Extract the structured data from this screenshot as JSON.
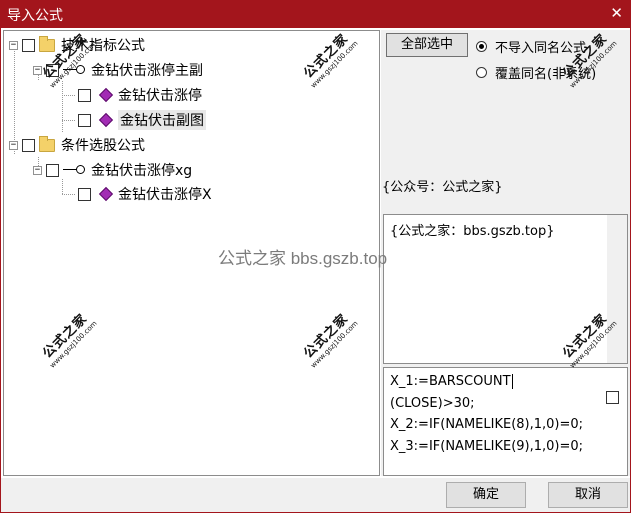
{
  "window": {
    "title": "导入公式",
    "close_symbol": "✕"
  },
  "tree": {
    "expander_minus": "−",
    "items": [
      {
        "label": "技术指标公式",
        "type": "folder"
      },
      {
        "label": "金钻伏击涨停主副",
        "type": "key"
      },
      {
        "label": "金钻伏击涨停",
        "type": "formula"
      },
      {
        "label": "金钻伏击副图",
        "type": "formula",
        "highlighted": true
      },
      {
        "label": "条件选股公式",
        "type": "folder"
      },
      {
        "label": "金钻伏击涨停xg",
        "type": "key"
      },
      {
        "label": "金钻伏击涨停X",
        "type": "formula"
      }
    ]
  },
  "options": {
    "select_all_label": "全部选中",
    "radio_no_import": "不导入同名公式",
    "radio_overwrite": "覆盖同名(非系统)",
    "selected": "radio_no_import"
  },
  "info_label": "{公众号：公式之家}",
  "description": "{公式之家：bbs.gszb.top}",
  "code_lines": [
    "X_1:=BARSCOUNT",
    "(CLOSE)>30;",
    "X_2:=IF(NAMELIKE(8),1,0)=0;",
    "X_3:=IF(NAMELIKE(9),1,0)=0;"
  ],
  "buttons": {
    "ok": "确定",
    "cancel": "取消"
  },
  "watermark": {
    "center_text": "公式之家 bbs.gszb.top",
    "stamp_big": "公式之家",
    "stamp_small": "www.gszj100.com"
  },
  "colors": {
    "titlebar": "#a3151c",
    "formula_icon": "#a22cb4",
    "folder_icon": "#f4d169"
  }
}
